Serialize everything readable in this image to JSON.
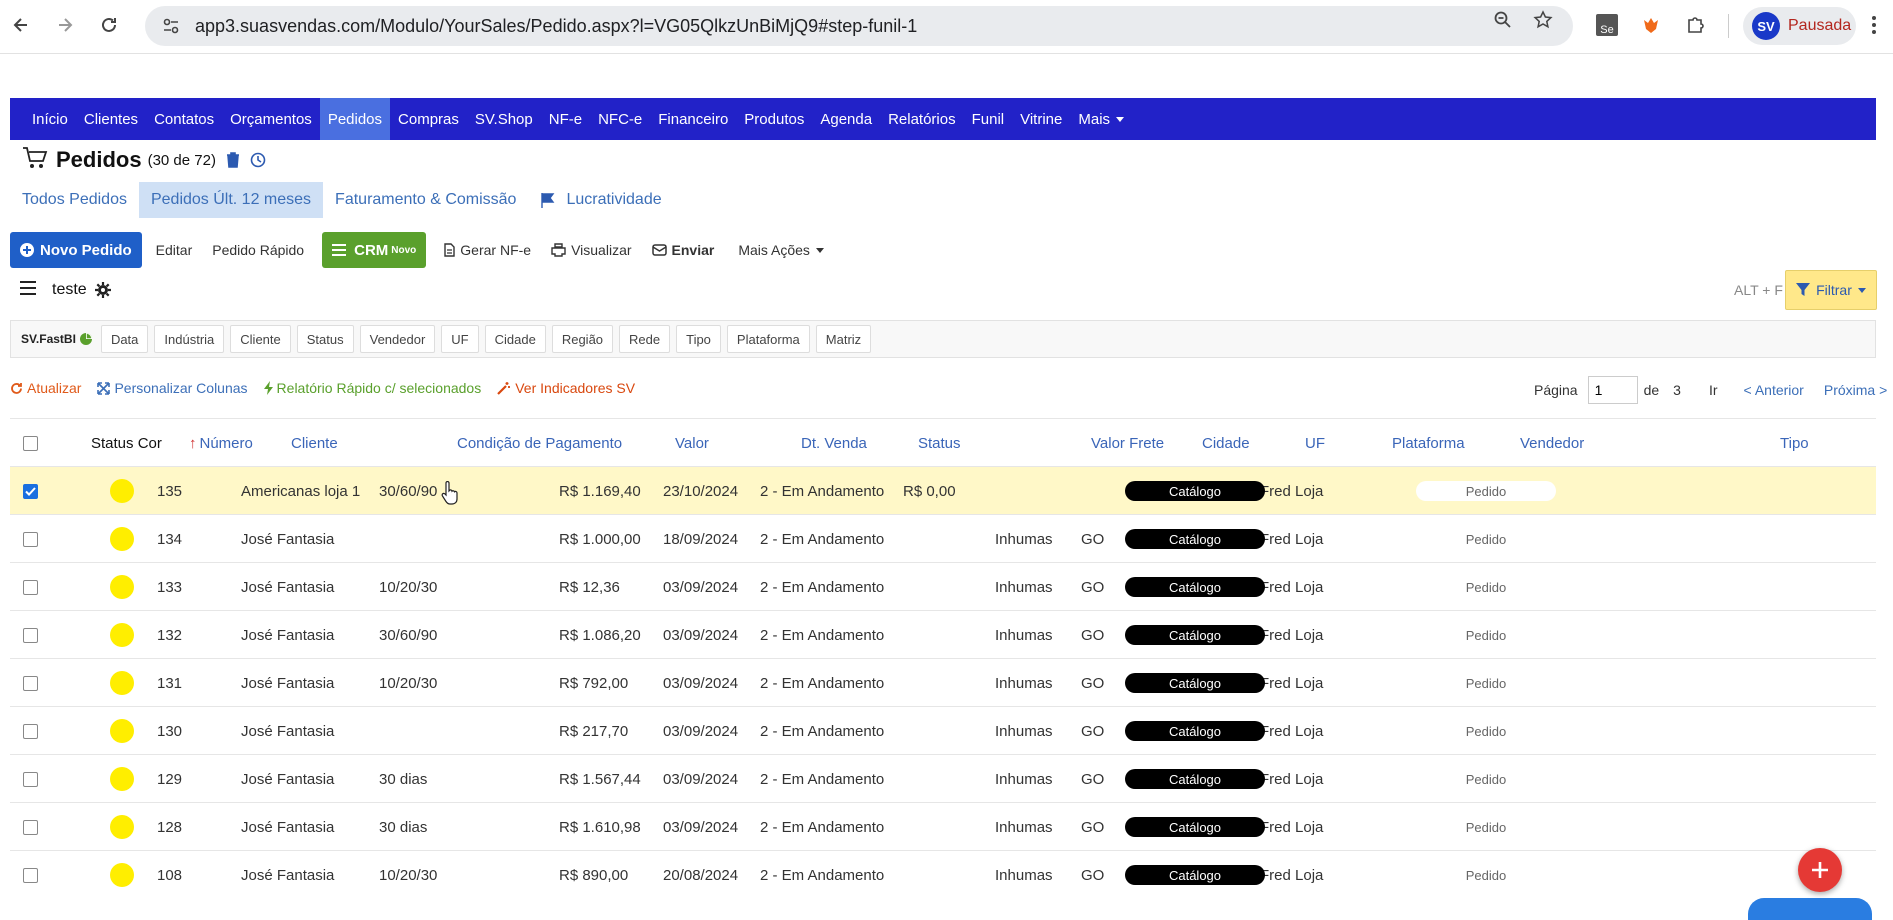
{
  "browser": {
    "url": "app3.suasvendas.com/Modulo/YourSales/Pedido.aspx?l=VG05QlkzUnBiMjQ9#step-funil-1",
    "profile_initials": "SV",
    "profile_status": "Pausada",
    "extension_badge": "Se"
  },
  "nav": {
    "items": [
      "Início",
      "Clientes",
      "Contatos",
      "Orçamentos",
      "Pedidos",
      "Compras",
      "SV.Shop",
      "NF-e",
      "NFC-e",
      "Financeiro",
      "Produtos",
      "Agenda",
      "Relatórios",
      "Funil",
      "Vitrine",
      "Mais"
    ],
    "active": "Pedidos"
  },
  "page": {
    "title": "Pedidos",
    "count": "(30 de 72)"
  },
  "tabs": [
    "Todos Pedidos",
    "Pedidos Últ. 12 meses",
    "Faturamento & Comissão",
    "Lucratividade"
  ],
  "toolbar": {
    "new": "Novo Pedido",
    "edit": "Editar",
    "quick": "Pedido Rápido",
    "crm": "CRM",
    "crm_badge": "Novo",
    "nfe": "Gerar NF-e",
    "view": "Visualizar",
    "send": "Enviar",
    "more": "Mais Ações"
  },
  "view": {
    "name": "teste",
    "shortcut": "ALT + F",
    "filter": "Filtrar"
  },
  "chips": {
    "brand_prefix": "SV.",
    "brand_suffix": "FastBI",
    "items": [
      "Data",
      "Indústria",
      "Cliente",
      "Status",
      "Vendedor",
      "UF",
      "Cidade",
      "Região",
      "Rede",
      "Tipo",
      "Plataforma",
      "Matriz"
    ]
  },
  "actions": {
    "refresh": "Atualizar",
    "columns": "Personalizar Colunas",
    "report": "Relatório Rápido c/ selecionados",
    "indicators": "Ver Indicadores SV",
    "colors": {
      "refresh": "#e05a1a",
      "columns": "#3c6fb8",
      "report": "#5aa02c",
      "indicators": "#d9480f"
    }
  },
  "pager": {
    "label": "Página",
    "page": "1",
    "of": "de",
    "total": "3",
    "go": "Ir",
    "prev": "< Anterior",
    "next": "Próxima >"
  },
  "table": {
    "headers": {
      "status_cor": "Status Cor",
      "numero": "Número",
      "cliente": "Cliente",
      "condicao": "Condição de Pagamento",
      "valor": "Valor",
      "dt_venda": "Dt. Venda",
      "status": "Status",
      "valor_frete": "Valor Frete",
      "cidade": "Cidade",
      "uf": "UF",
      "plataforma": "Plataforma",
      "vendedor": "Vendedor",
      "tipo": "Tipo"
    },
    "rows": [
      {
        "selected": true,
        "numero": "135",
        "cliente": "Americanas loja 1",
        "condicao": "30/60/90",
        "valor": "R$ 1.169,40",
        "dt_venda": "23/10/2024",
        "status": "2 - Em Andamento",
        "valor_frete": "R$ 0,00",
        "cidade": "",
        "uf": "",
        "plataforma": "Catálogo",
        "vendedor": "Fred Loja",
        "tipo": "Pedido"
      },
      {
        "selected": false,
        "numero": "134",
        "cliente": "José Fantasia",
        "condicao": "",
        "valor": "R$ 1.000,00",
        "dt_venda": "18/09/2024",
        "status": "2 - Em Andamento",
        "valor_frete": "",
        "cidade": "Inhumas",
        "uf": "GO",
        "plataforma": "Catálogo",
        "vendedor": "Fred Loja",
        "tipo": "Pedido"
      },
      {
        "selected": false,
        "numero": "133",
        "cliente": "José Fantasia",
        "condicao": "10/20/30",
        "valor": "R$ 12,36",
        "dt_venda": "03/09/2024",
        "status": "2 - Em Andamento",
        "valor_frete": "",
        "cidade": "Inhumas",
        "uf": "GO",
        "plataforma": "Catálogo",
        "vendedor": "Fred Loja",
        "tipo": "Pedido"
      },
      {
        "selected": false,
        "numero": "132",
        "cliente": "José Fantasia",
        "condicao": "30/60/90",
        "valor": "R$ 1.086,20",
        "dt_venda": "03/09/2024",
        "status": "2 - Em Andamento",
        "valor_frete": "",
        "cidade": "Inhumas",
        "uf": "GO",
        "plataforma": "Catálogo",
        "vendedor": "Fred Loja",
        "tipo": "Pedido"
      },
      {
        "selected": false,
        "numero": "131",
        "cliente": "José Fantasia",
        "condicao": "10/20/30",
        "valor": "R$ 792,00",
        "dt_venda": "03/09/2024",
        "status": "2 - Em Andamento",
        "valor_frete": "",
        "cidade": "Inhumas",
        "uf": "GO",
        "plataforma": "Catálogo",
        "vendedor": "Fred Loja",
        "tipo": "Pedido"
      },
      {
        "selected": false,
        "numero": "130",
        "cliente": "José Fantasia",
        "condicao": "",
        "valor": "R$ 217,70",
        "dt_venda": "03/09/2024",
        "status": "2 - Em Andamento",
        "valor_frete": "",
        "cidade": "Inhumas",
        "uf": "GO",
        "plataforma": "Catálogo",
        "vendedor": "Fred Loja",
        "tipo": "Pedido"
      },
      {
        "selected": false,
        "numero": "129",
        "cliente": "José Fantasia",
        "condicao": "30 dias",
        "valor": "R$ 1.567,44",
        "dt_venda": "03/09/2024",
        "status": "2 - Em Andamento",
        "valor_frete": "",
        "cidade": "Inhumas",
        "uf": "GO",
        "plataforma": "Catálogo",
        "vendedor": "Fred Loja",
        "tipo": "Pedido"
      },
      {
        "selected": false,
        "numero": "128",
        "cliente": "José Fantasia",
        "condicao": "30 dias",
        "valor": "R$ 1.610,98",
        "dt_venda": "03/09/2024",
        "status": "2 - Em Andamento",
        "valor_frete": "",
        "cidade": "Inhumas",
        "uf": "GO",
        "plataforma": "Catálogo",
        "vendedor": "Fred Loja",
        "tipo": "Pedido"
      },
      {
        "selected": false,
        "numero": "108",
        "cliente": "José Fantasia",
        "condicao": "10/20/30",
        "valor": "R$ 890,00",
        "dt_venda": "20/08/2024",
        "status": "2 - Em Andamento",
        "valor_frete": "",
        "cidade": "Inhumas",
        "uf": "GO",
        "plataforma": "Catálogo",
        "vendedor": "Fred Loja",
        "tipo": "Pedido"
      }
    ]
  },
  "colors": {
    "nav_bg": "#2222c8",
    "nav_active": "#4a6fe0",
    "status_dot": "#ffee00",
    "selected_row": "#fff8c8",
    "primary": "#1f5fc8",
    "crm": "#5aa02c",
    "filter_bg": "#ffe88a"
  }
}
